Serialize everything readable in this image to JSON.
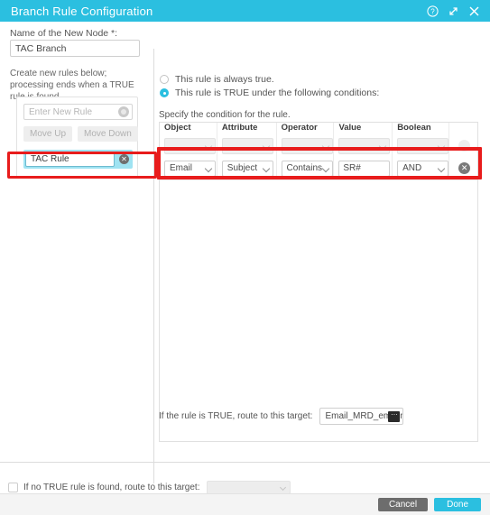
{
  "window": {
    "title": "Branch Rule Configuration",
    "accent_color": "#2bbfe0",
    "highlight_color": "#e81c1c",
    "icons": {
      "help": "help-circle-icon",
      "expand": "expand-diagonal-icon",
      "close": "close-x-icon"
    }
  },
  "left_panel": {
    "node_name_label": "Name of the New Node *:",
    "node_name_value": "TAC Branch",
    "help_text": "Create new rules below; processing ends when a TRUE rule is found.",
    "new_rule_placeholder": "Enter New Rule",
    "new_rule_value": "",
    "add_icon": "add-circle-icon",
    "move_up_label": "Move Up",
    "move_down_label": "Move Down",
    "rules": [
      {
        "name": "TAC Rule",
        "delete_icon": "delete-circle-icon",
        "selected": true
      }
    ]
  },
  "right_panel": {
    "radio_options": [
      {
        "label": "This rule is always true.",
        "selected": false
      },
      {
        "label": "This rule is TRUE under the following conditions:",
        "selected": true
      }
    ],
    "condition_caption": "Specify the condition for the rule.",
    "table": {
      "headers": [
        "Object",
        "Attribute",
        "Operator",
        "Value",
        "Boolean",
        ""
      ],
      "rows": [
        {
          "object": "",
          "attribute": "",
          "operator": "",
          "value": "",
          "boolean": "",
          "disabled": true,
          "delete_icon": "delete-circle-icon"
        },
        {
          "object": "Email",
          "attribute": "Subject",
          "operator": "Contains",
          "value": "SR#",
          "boolean": "AND",
          "disabled": false,
          "delete_icon": "delete-circle-icon"
        }
      ]
    },
    "route_true_label": "If the rule is TRUE, route to this target:",
    "route_true_value": "Email_MRD_emailn",
    "route_browse_icon": "ellipsis-button-icon"
  },
  "footer": {
    "fallback_label": "If no TRUE rule is found, route to this target:",
    "fallback_checked": false,
    "fallback_value": "",
    "cancel_label": "Cancel",
    "done_label": "Done"
  }
}
